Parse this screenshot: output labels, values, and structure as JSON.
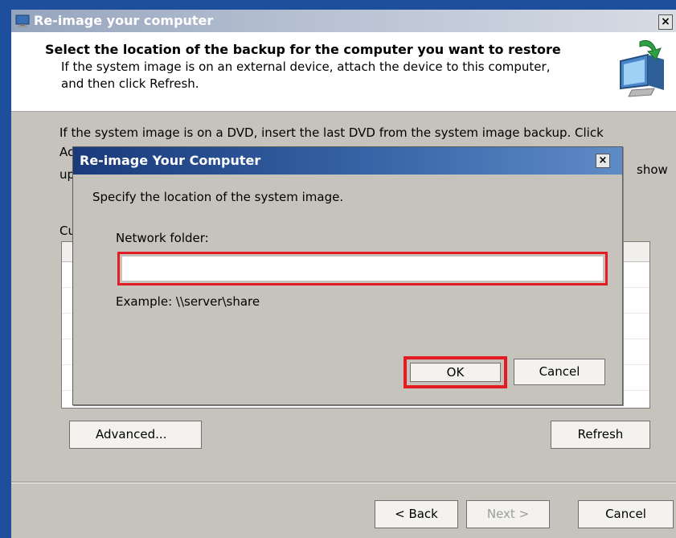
{
  "wizard": {
    "title": "Re-image your computer",
    "header_title": "Select the location of the backup for the computer you want to restore",
    "header_desc_line1": "If the system image is on an external device, attach the device to this computer,",
    "header_desc_line2": "and then click Refresh.",
    "body_line1": "If the system image is on a DVD, insert the last DVD from the system image backup. Click",
    "body_line2_start": "Ac",
    "body_line2_end": "show",
    "body_line3_start": "up",
    "list_label_start": "Cu",
    "advanced_label": "Advanced...",
    "refresh_label": "Refresh",
    "back_label": "< Back",
    "next_label": "Next >",
    "cancel_label": "Cancel",
    "close_glyph": "×"
  },
  "dialog": {
    "title": "Re-image Your Computer",
    "close_glyph": "×",
    "prompt": "Specify the location of the system image.",
    "network_label": "Network folder:",
    "network_value": "",
    "example": "Example: \\\\server\\share",
    "ok_label": "OK",
    "cancel_label": "Cancel"
  },
  "colors": {
    "highlight": "#e31b23",
    "dialog_title_bar": "#1a3a7a",
    "window_bg": "#c6c3bd"
  },
  "icons": [
    "window-app-icon",
    "computer-restore-icon",
    "close-icon"
  ]
}
